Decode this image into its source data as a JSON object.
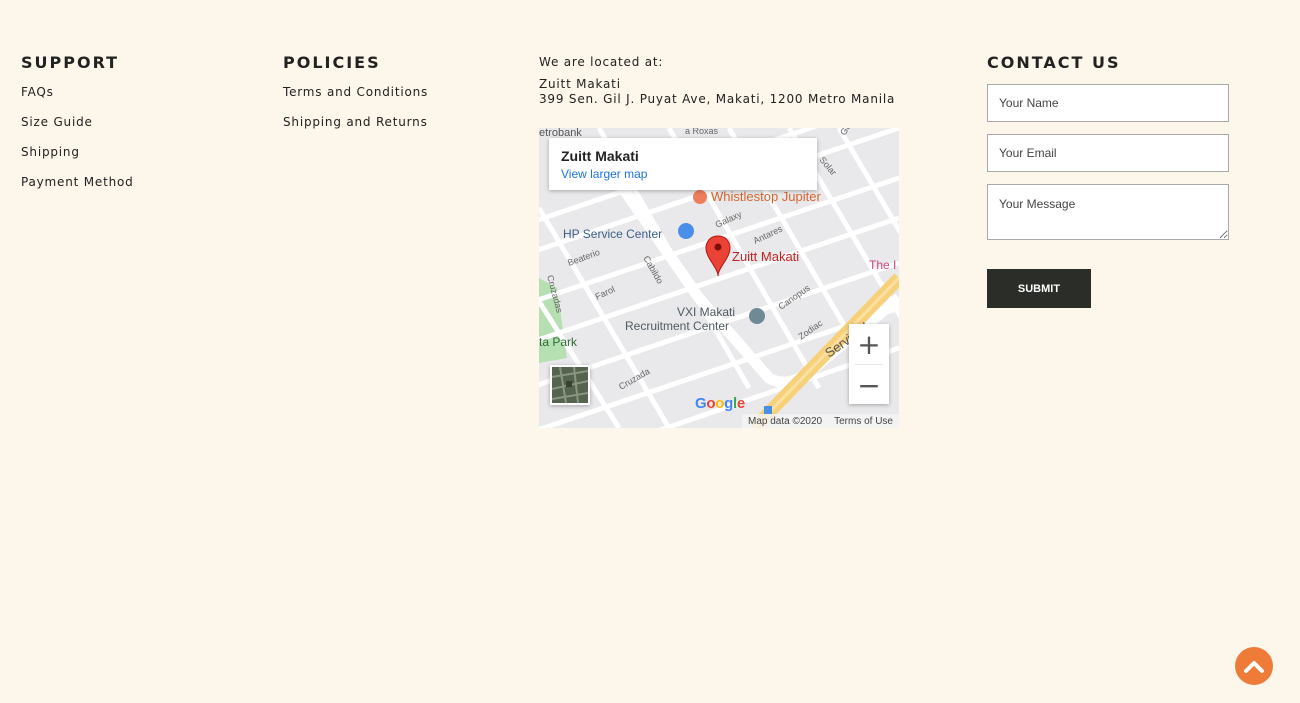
{
  "support": {
    "title": "SUPPORT",
    "links": [
      "FAQs",
      "Size Guide",
      "Shipping",
      "Payment Method"
    ]
  },
  "policies": {
    "title": "POLICIES",
    "links": [
      "Terms and Conditions",
      "Shipping and Returns"
    ]
  },
  "location": {
    "label": "We are located at:",
    "name": "Zuitt Makati",
    "address": "399 Sen. Gil J. Puyat Ave, Makati, 1200 Metro Manila"
  },
  "map": {
    "card_title": "Zuitt Makati",
    "card_link": "View larger map",
    "pin_label": "Zuitt Makati",
    "pois": [
      "Whistlestop Jupiter",
      "HP Service Center",
      "VXI Makati",
      "Recruitment Center",
      "ta Park",
      "The I",
      "etrobank"
    ],
    "streets": [
      "Galaxy",
      "Antares",
      "Beaterio",
      "Cabildo",
      "Cruzadas",
      "Farol",
      "Canopus",
      "Zodiac",
      "Servi Rd",
      "Cruzada",
      "Solar",
      "a Roxas",
      "Ga"
    ],
    "attribution": "Map data ©2020",
    "terms": "Terms of Use",
    "logo": "Google",
    "zoom_in": "+",
    "zoom_out": "−"
  },
  "contact": {
    "title": "CONTACT US",
    "name_placeholder": "Your Name",
    "email_placeholder": "Your Email",
    "message_placeholder": "Your Message",
    "submit_label": "SUBMIT"
  },
  "colors": {
    "background": "#fdf6ea",
    "submit_bg": "#2b2d28",
    "scroll_top_bg": "#ef7b39",
    "map_pin": "#ea4335",
    "map_link": "#1a73e8"
  }
}
